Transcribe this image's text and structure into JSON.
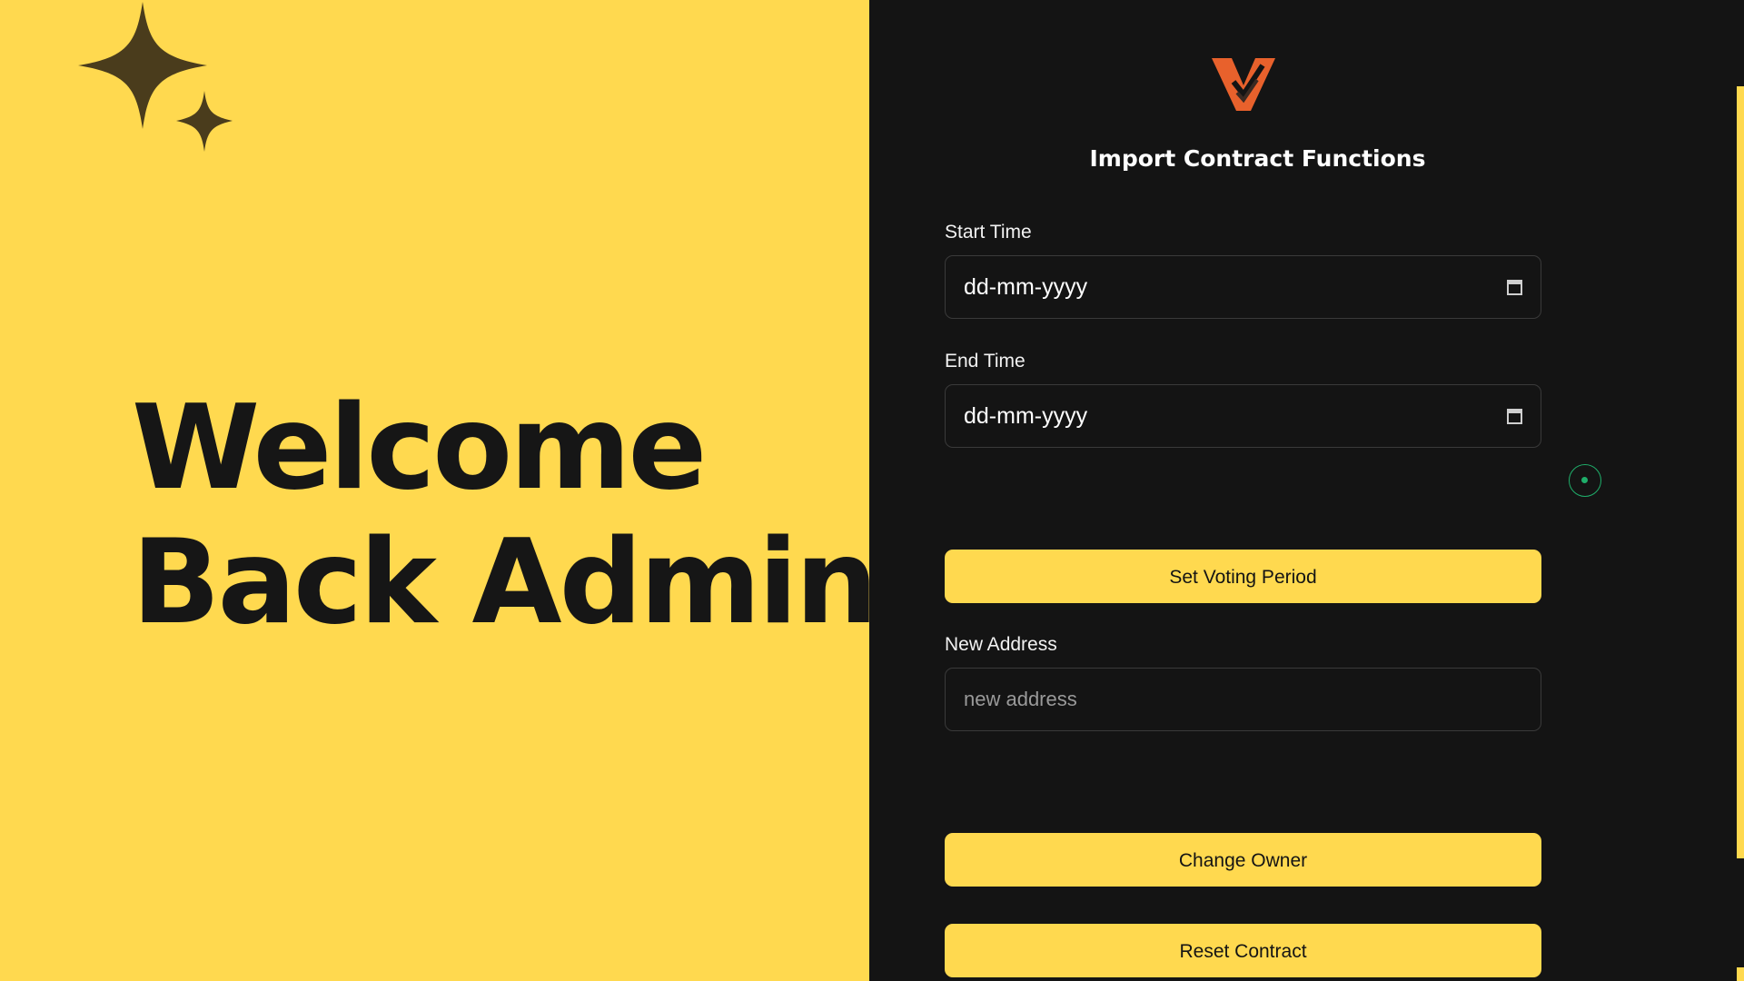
{
  "hero": {
    "line1": "Welcome",
    "line2": "Back Admin!"
  },
  "form": {
    "title": "Import Contract Functions",
    "start_time": {
      "label": "Start Time",
      "value": "dd-mm-yyyy"
    },
    "end_time": {
      "label": "End Time",
      "value": "dd-mm-yyyy"
    },
    "set_voting_period_label": "Set Voting Period",
    "new_address": {
      "label": "New Address",
      "placeholder": "new address"
    },
    "change_owner_label": "Change Owner",
    "reset_contract_label": "Reset Contract"
  },
  "icons": {
    "sparkles": "sparkles-icon",
    "logo": "vote-logo-icon",
    "calendar": "calendar-icon",
    "status": "radio-indicator-icon"
  },
  "colors": {
    "accent": "#FFD94F",
    "background_dark": "#141414",
    "text_dark": "#161616",
    "logo_orange": "#E8612C",
    "status_green": "#1fae6a"
  }
}
